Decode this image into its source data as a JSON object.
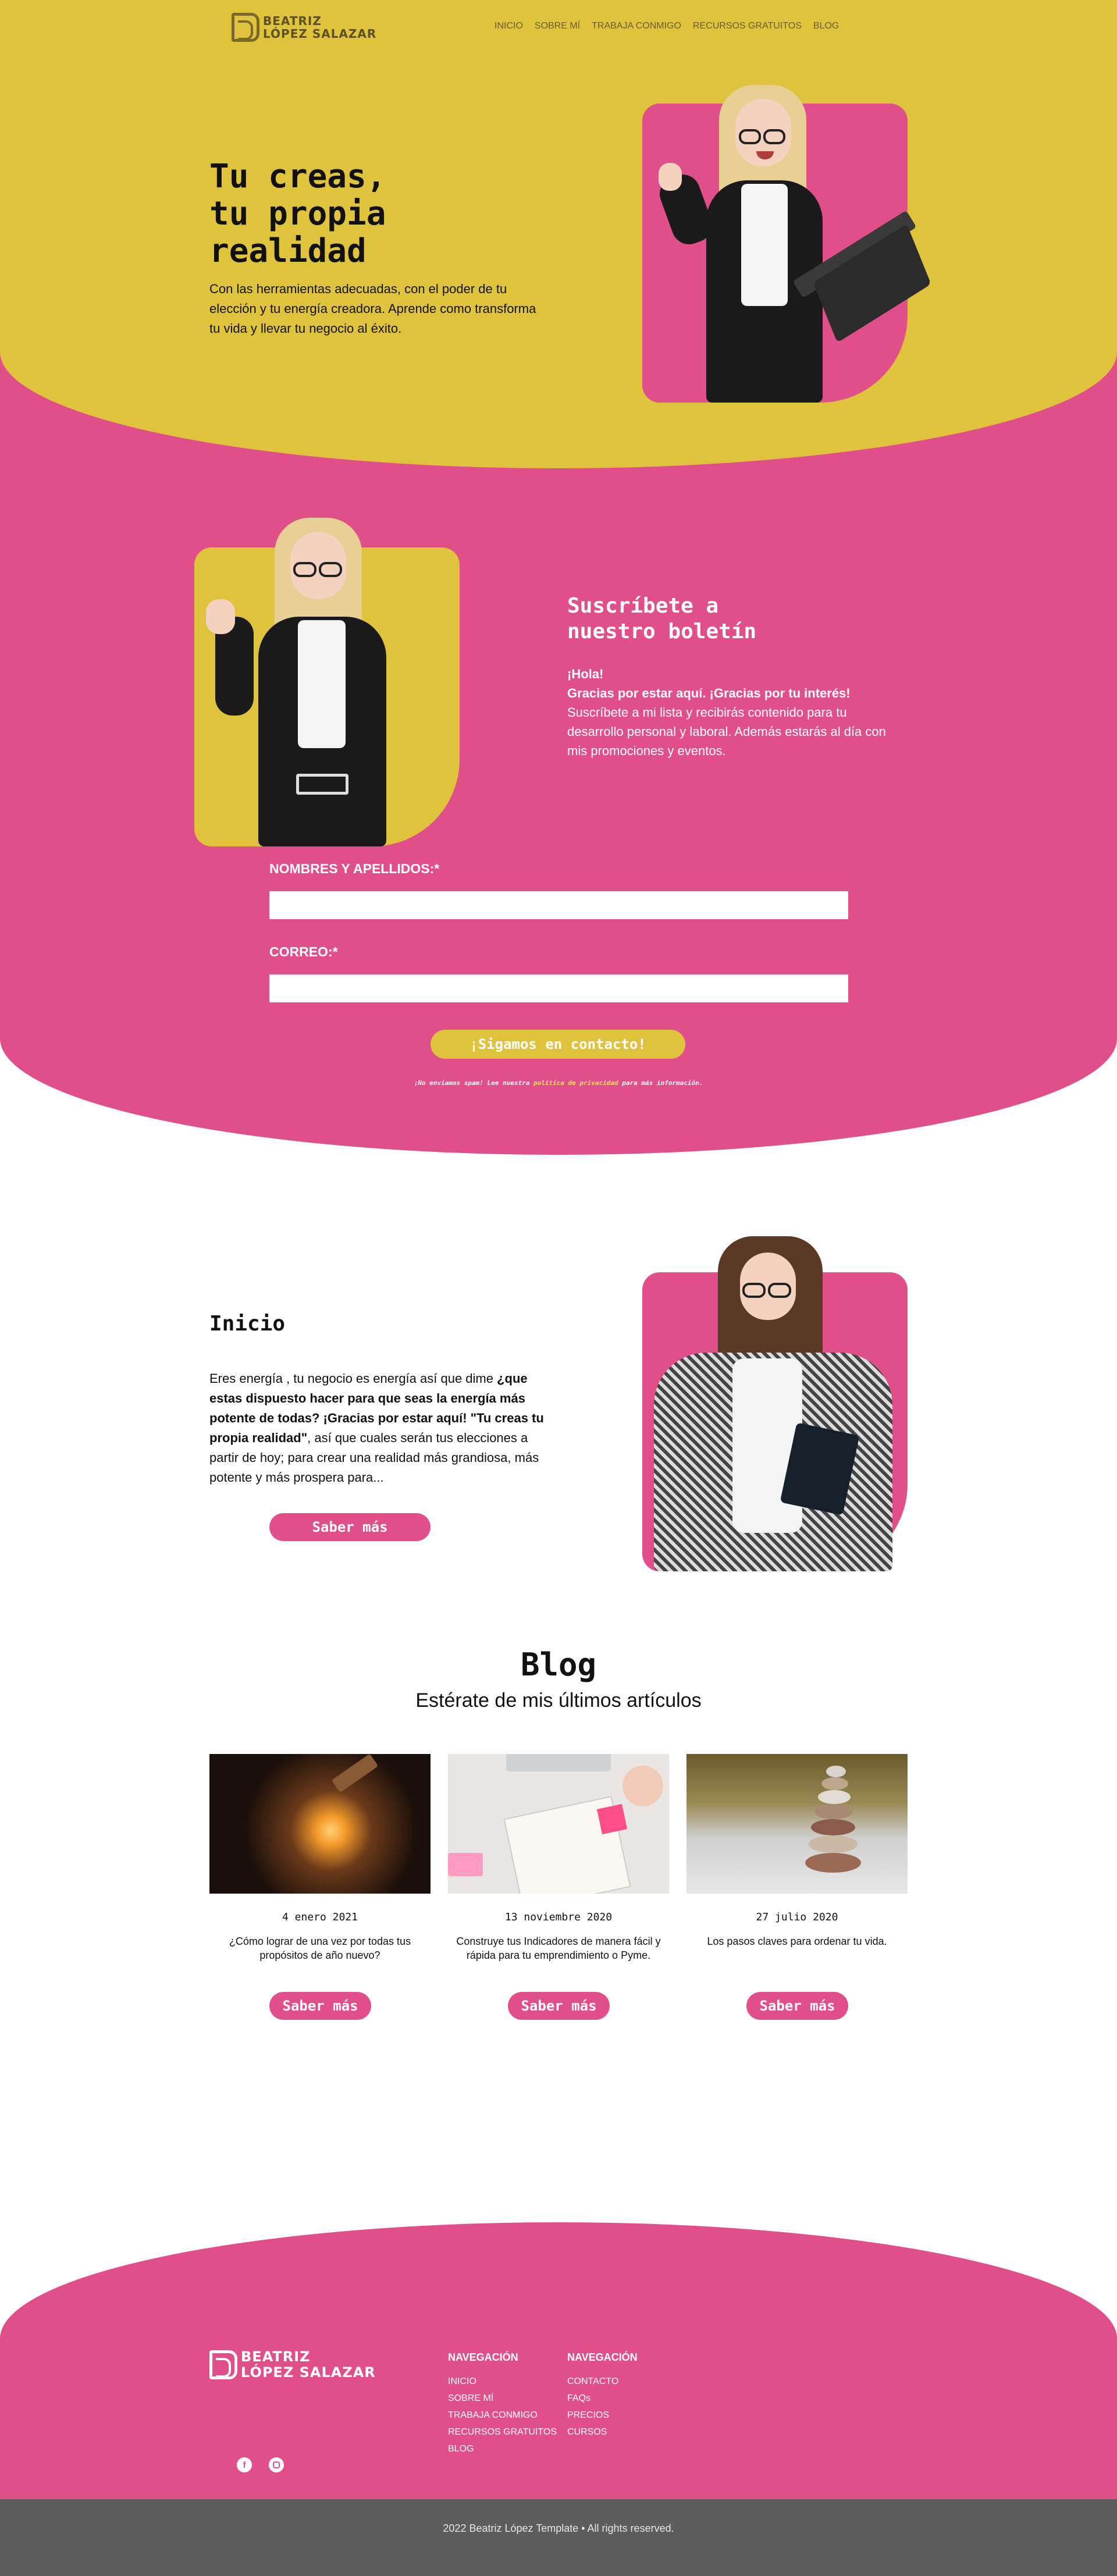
{
  "brand": {
    "line1": "BEATRIZ",
    "line2": "LÓPEZ SALAZAR"
  },
  "nav": [
    "INICIO",
    "SOBRE MÍ",
    "TRABAJA CONMIGO",
    "RECURSOS GRATUITOS",
    "BLOG"
  ],
  "hero": {
    "title_lines": [
      "Tu creas,",
      "tu propia",
      "realidad"
    ],
    "text": "Con las herramientas adecuadas, con el poder de tu elección y tu energía creadora. Aprende como transforma tu vida y llevar tu negocio al éxito."
  },
  "subscribe": {
    "title_lines": [
      "Suscríbete a",
      "nuestro boletín"
    ],
    "greeting": "¡Hola!",
    "thanks": "Gracias por estar aquí. ¡Gracias por tu interés!",
    "text": "Suscríbete a mi lista y recibirás contenido para tu desarrollo personal y laboral. Además estarás al día con mis promociones y eventos.",
    "name_label": "NOMBRES Y APELLIDOS:*",
    "email_label": "CORREO:*",
    "button": "¡Sigamos en contacto!",
    "disclaimer_pre": "¡No enviamos spam! Lee nuestra ",
    "disclaimer_link": "política de privacidad",
    "disclaimer_post": " para más información."
  },
  "inicio": {
    "title": "Inicio",
    "text_1": "Eres energía , tu negocio es energía así que dime ",
    "text_bold": "¿que estas dispuesto hacer para que seas la energía más potente de todas? ¡Gracias por estar aquí! \"Tu creas tu propia realidad\"",
    "text_2": ", así que cuales serán tus elecciones a partir de hoy; para crear una realidad más grandiosa, más potente y más prospera para...",
    "button": "Saber más"
  },
  "blog": {
    "title": "Blog",
    "subtitle": "Estérate de mis últimos artículos",
    "posts": [
      {
        "date": "4 enero 2021",
        "text": "¿Cómo lograr de una vez por todas tus propósitos de año nuevo?",
        "button": "Saber más"
      },
      {
        "date": "13 noviembre 2020",
        "text": "Construye tus Indicadores de manera fácil y rápida para tu emprendimiento o Pyme.",
        "button": "Saber más"
      },
      {
        "date": "27 julio 2020",
        "text": "Los pasos claves para ordenar tu vida.",
        "button": "Saber más"
      }
    ]
  },
  "footer": {
    "col1": {
      "title": "NAVEGACIÓN",
      "items": [
        "INICIO",
        "SOBRE MÍ",
        "TRABAJA CONMIGO",
        "RECURSOS GRATUITOS",
        "BLOG"
      ]
    },
    "col2": {
      "title": "NAVEGACIÓN",
      "items": [
        "CONTACTO",
        "FAQs",
        "PRECIOS",
        "CURSOS"
      ]
    },
    "social": [
      "facebook-icon",
      "instagram-icon"
    ],
    "copyright": "2022 Beatriz López Template • All rights reserved."
  },
  "colors": {
    "yellow": "#dfc33c",
    "pink": "#e04f89",
    "gray": "#5d5d5d"
  }
}
